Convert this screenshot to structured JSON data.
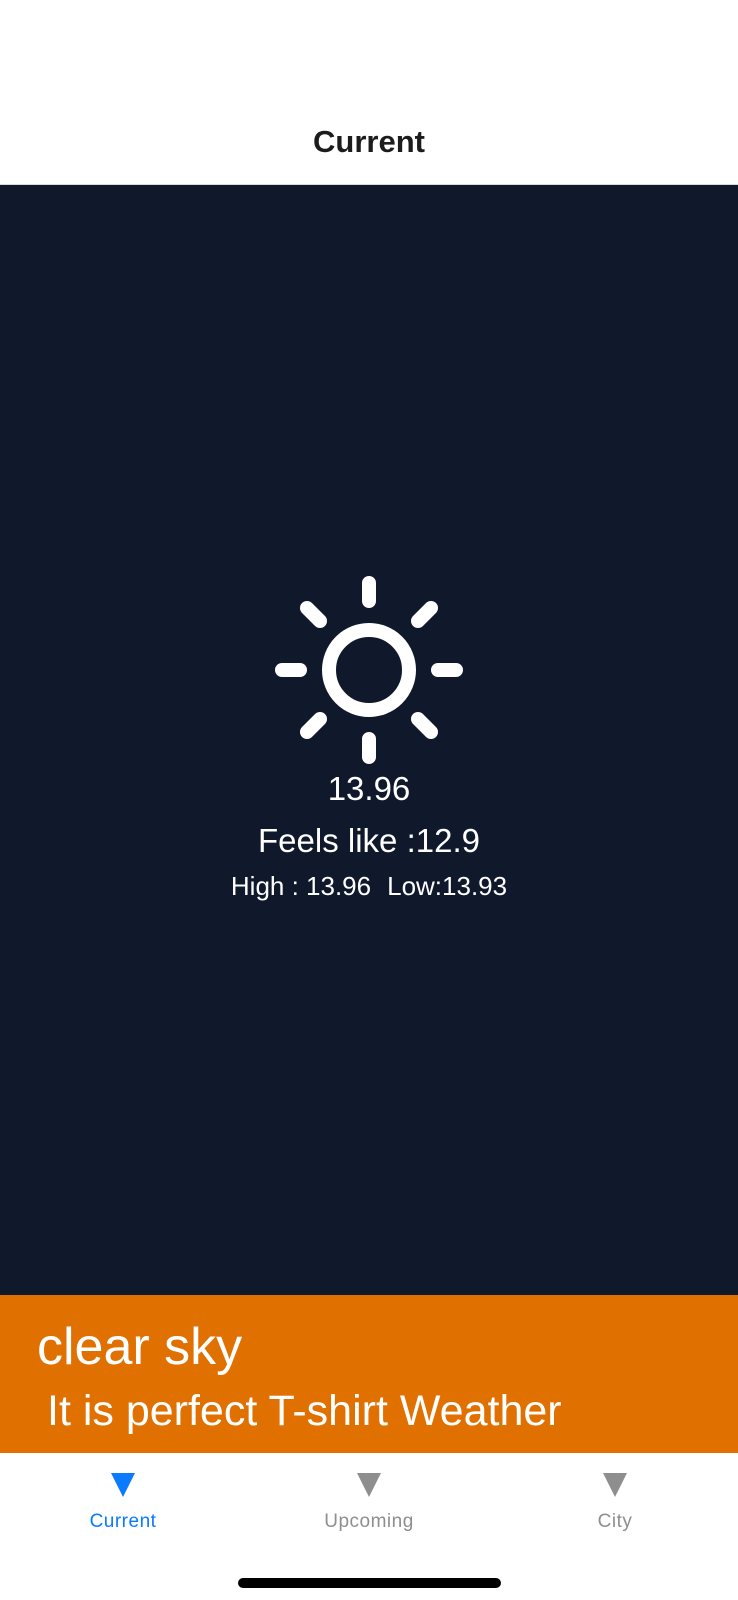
{
  "header": {
    "title": "Current"
  },
  "weather": {
    "icon": "sun-icon",
    "temperature": "13.96",
    "feels_like": "Feels like :12.9",
    "high": "High : 13.96",
    "low": "Low:13.93"
  },
  "banner": {
    "condition": "clear sky",
    "advice": "It is perfect T-shirt Weather",
    "color": "#e07000"
  },
  "tabs": [
    {
      "label": "Current",
      "icon": "triangle-down-icon",
      "active": true
    },
    {
      "label": "Upcoming",
      "icon": "triangle-down-icon",
      "active": false
    },
    {
      "label": "City",
      "icon": "triangle-down-icon",
      "active": false
    }
  ],
  "colors": {
    "background": "#10182b",
    "accent": "#0a7aff",
    "inactive": "#8e8e8e"
  }
}
